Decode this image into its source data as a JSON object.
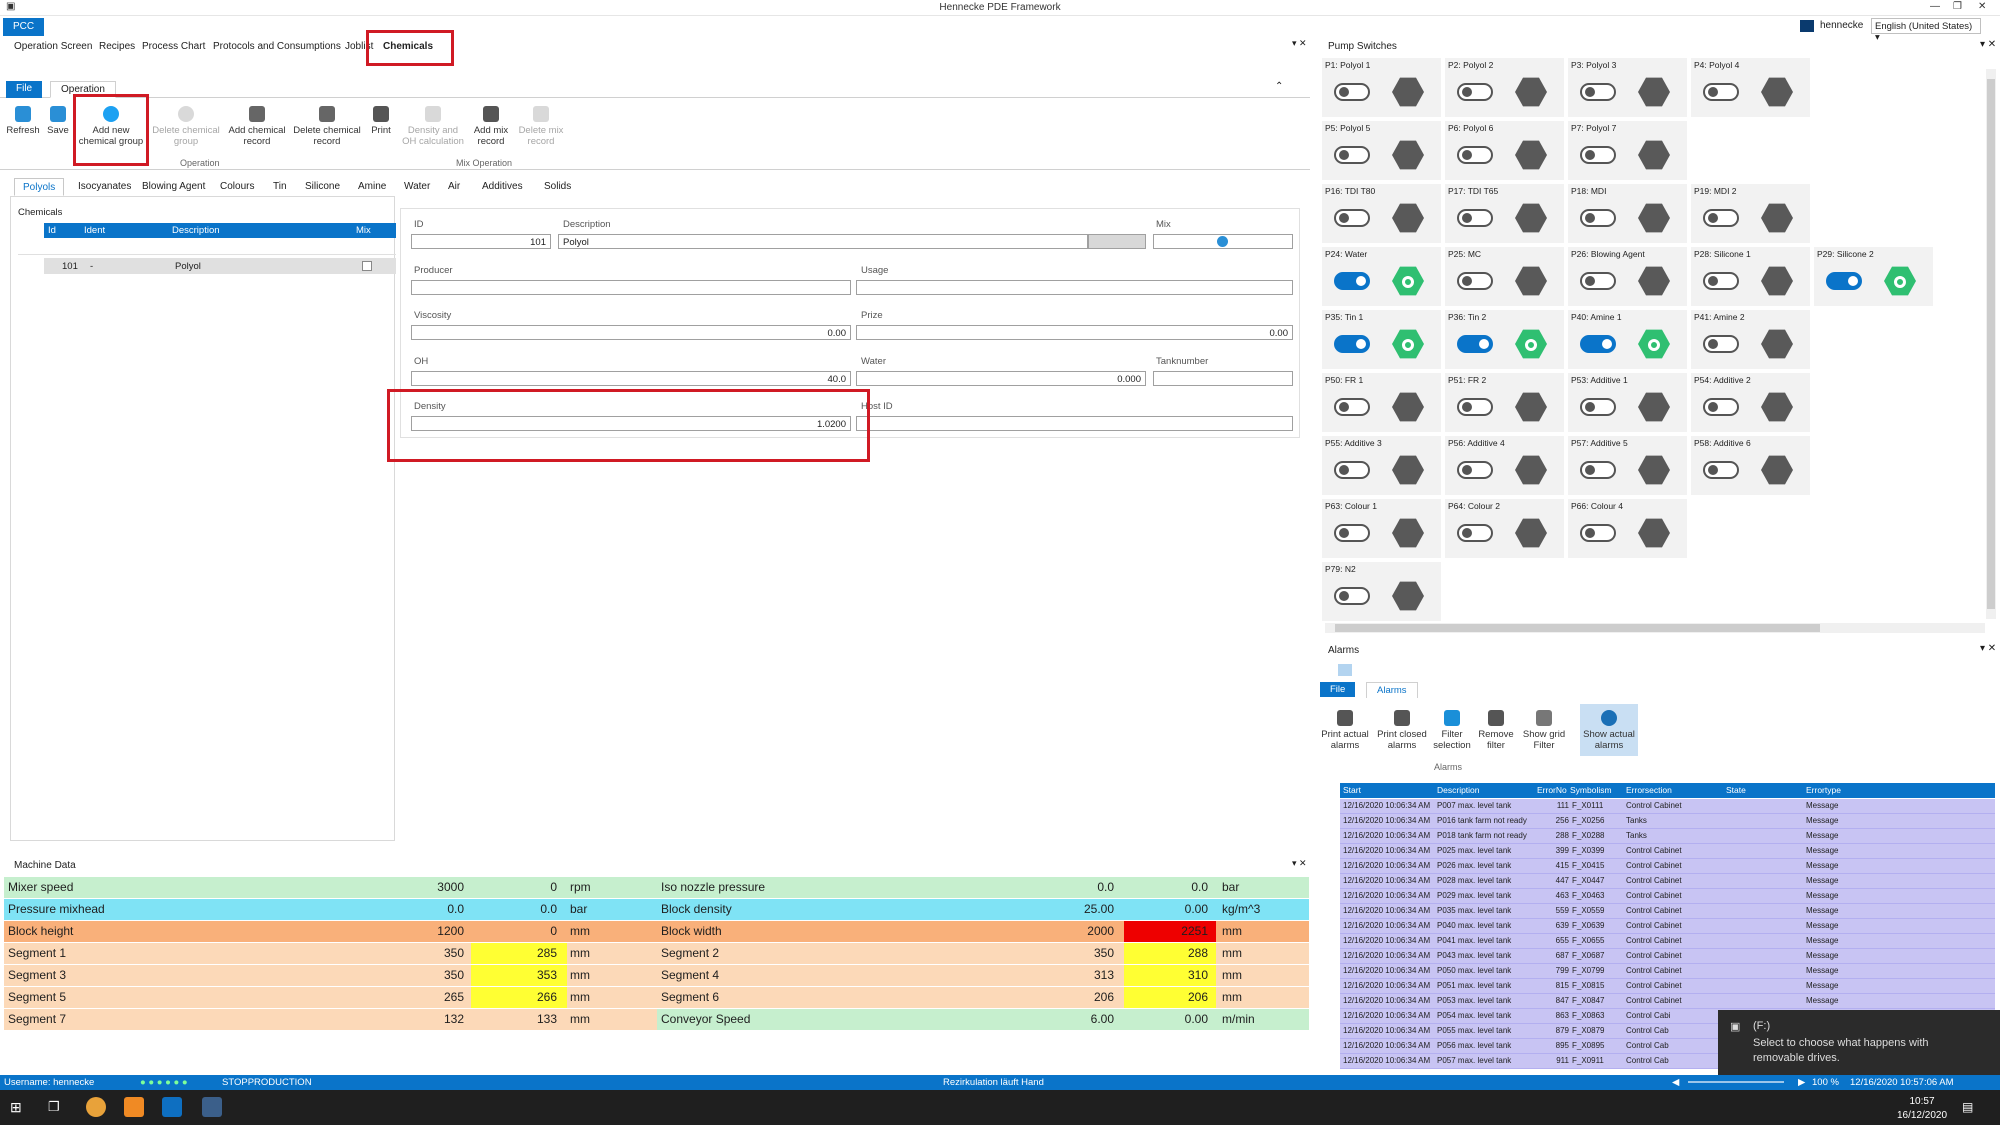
{
  "app": {
    "title": "Hennecke PDE Framework",
    "user": "hennecke",
    "language": "English (United States)",
    "pcc": "PCC"
  },
  "nav": {
    "tabs": [
      "Operation Screen",
      "Recipes",
      "Process Chart",
      "Protocols and Consumptions",
      "Joblist",
      "Chemicals"
    ],
    "active": "Chemicals"
  },
  "ribbon": {
    "tabs": {
      "file": "File",
      "operation": "Operation"
    },
    "buttons": {
      "refresh": "Refresh",
      "save": "Save",
      "add_group": "Add new chemical group",
      "delete_group": "Delete chemical group",
      "add_record": "Add chemical record",
      "delete_record": "Delete chemical record",
      "print": "Print",
      "density_oh": "Density and OH calculation",
      "add_mix": "Add mix record",
      "delete_mix": "Delete mix record"
    },
    "groups": {
      "operation": "Operation",
      "mix_operation": "Mix Operation"
    }
  },
  "chem_tabs": [
    "Polyols",
    "Isocyanates",
    "Blowing Agent",
    "Colours",
    "Tin",
    "Silicone",
    "Amine",
    "Water",
    "Air",
    "Additives",
    "Solids"
  ],
  "chemicals": {
    "label": "Chemicals",
    "columns": [
      "Id",
      "Ident",
      "Description",
      "Mix"
    ],
    "rows": [
      {
        "id": "101",
        "ident": "-",
        "description": "Polyol"
      }
    ]
  },
  "form": {
    "id_label": "ID",
    "id": "101",
    "desc_label": "Description",
    "desc": "Polyol",
    "mix_label": "Mix",
    "producer_label": "Producer",
    "usage_label": "Usage",
    "viscosity_label": "Viscosity",
    "viscosity": "0.00",
    "prize_label": "Prize",
    "prize": "0.00",
    "oh_label": "OH",
    "oh": "40.0",
    "water_label": "Water",
    "water": "0.000",
    "tank_label": "Tanknumber",
    "density_label": "Density",
    "density": "1.0200",
    "host_label": "Host ID"
  },
  "machine": {
    "title": "Machine Data",
    "rows": [
      {
        "l_name": "Mixer speed",
        "l_set": "3000",
        "l_act": "0",
        "l_unit": "rpm",
        "r_name": "Iso nozzle pressure",
        "r_set": "0.0",
        "r_act": "0.0",
        "r_unit": "bar",
        "l_color": "#c6efce",
        "r_color": "#c6efce",
        "l_act_color": "",
        "r_act_color": ""
      },
      {
        "l_name": "Pressure mixhead",
        "l_set": "0.0",
        "l_act": "0.0",
        "l_unit": "bar",
        "r_name": "Block density",
        "r_set": "25.00",
        "r_act": "0.00",
        "r_unit": "kg/m^3",
        "l_color": "#7fe3f5",
        "r_color": "#7fe3f5",
        "l_act_color": "",
        "r_act_color": ""
      },
      {
        "l_name": "Block height",
        "l_set": "1200",
        "l_act": "0",
        "l_unit": "mm",
        "r_name": "Block width",
        "r_set": "2000",
        "r_act": "2251",
        "r_unit": "mm",
        "l_color": "#f9b07a",
        "r_color": "#f9b07a",
        "l_act_color": "",
        "r_act_color": "#ee0000"
      },
      {
        "l_name": "Segment 1",
        "l_set": "350",
        "l_act": "285",
        "l_unit": "mm",
        "r_name": "Segment 2",
        "r_set": "350",
        "r_act": "288",
        "r_unit": "mm",
        "l_color": "#fcd9b8",
        "r_color": "#fcd9b8",
        "l_act_color": "#ffff33",
        "r_act_color": "#ffff33"
      },
      {
        "l_name": "Segment 3",
        "l_set": "350",
        "l_act": "353",
        "l_unit": "mm",
        "r_name": "Segment 4",
        "r_set": "313",
        "r_act": "310",
        "r_unit": "mm",
        "l_color": "#fcd9b8",
        "r_color": "#fcd9b8",
        "l_act_color": "#ffff33",
        "r_act_color": "#ffff33"
      },
      {
        "l_name": "Segment 5",
        "l_set": "265",
        "l_act": "266",
        "l_unit": "mm",
        "r_name": "Segment 6",
        "r_set": "206",
        "r_act": "206",
        "r_unit": "mm",
        "l_color": "#fcd9b8",
        "r_color": "#fcd9b8",
        "l_act_color": "#ffff33",
        "r_act_color": "#ffff33"
      },
      {
        "l_name": "Segment 7",
        "l_set": "132",
        "l_act": "133",
        "l_unit": "mm",
        "r_name": "Conveyor Speed",
        "r_set": "6.00",
        "r_act": "0.00",
        "r_unit": "m/min",
        "l_color": "#fcd9b8",
        "r_color": "#c6efce",
        "l_act_color": "",
        "r_act_color": ""
      }
    ]
  },
  "pumps": {
    "title": "Pump Switches",
    "items": [
      {
        "label": "P1: Polyol 1",
        "on": false
      },
      {
        "label": "P2: Polyol 2",
        "on": false
      },
      {
        "label": "P3: Polyol 3",
        "on": false
      },
      {
        "label": "P4: Polyol 4",
        "on": false
      },
      {
        "label": "P5: Polyol 5",
        "on": false
      },
      {
        "label": "P6: Polyol 6",
        "on": false
      },
      {
        "label": "P7: Polyol 7",
        "on": false
      },
      {
        "label": "P16: TDI T80",
        "on": false
      },
      {
        "label": "P17: TDI T65",
        "on": false
      },
      {
        "label": "P18: MDI",
        "on": false
      },
      {
        "label": "P19: MDI 2",
        "on": false
      },
      {
        "label": "P24: Water",
        "on": true
      },
      {
        "label": "P25: MC",
        "on": false
      },
      {
        "label": "P26: Blowing Agent",
        "on": false
      },
      {
        "label": "P28: Silicone 1",
        "on": false
      },
      {
        "label": "P29: Silicone 2",
        "on": true
      },
      {
        "label": "P35: Tin 1",
        "on": true
      },
      {
        "label": "P36: Tin 2",
        "on": true
      },
      {
        "label": "P40: Amine 1",
        "on": true
      },
      {
        "label": "P41: Amine 2",
        "on": false
      },
      {
        "label": "P50: FR 1",
        "on": false
      },
      {
        "label": "P51: FR 2",
        "on": false
      },
      {
        "label": "P53: Additive 1",
        "on": false
      },
      {
        "label": "P54: Additive 2",
        "on": false
      },
      {
        "label": "P55: Additive 3",
        "on": false
      },
      {
        "label": "P56: Additive 4",
        "on": false
      },
      {
        "label": "P57: Additive 5",
        "on": false
      },
      {
        "label": "P58: Additive 6",
        "on": false
      },
      {
        "label": "P63: Colour 1",
        "on": false
      },
      {
        "label": "P64: Colour 2",
        "on": false
      },
      {
        "label": "P66: Colour 4",
        "on": false
      },
      {
        "label": "P79: N2",
        "on": false
      }
    ]
  },
  "alarms": {
    "title": "Alarms",
    "tabs": {
      "file": "File",
      "alarms": "Alarms"
    },
    "buttons": {
      "print_actual": "Print actual alarms",
      "print_closed": "Print closed alarms",
      "filter": "Filter selection",
      "remove_filter": "Remove filter",
      "grid_filter": "Show grid Filter",
      "show_actual": "Show actual alarms"
    },
    "group": "Alarms",
    "columns": [
      "Start",
      "Description",
      "ErrorNo",
      "Symbolism",
      "Errorsection",
      "State",
      "Errortype"
    ],
    "rows": [
      {
        "start": "12/16/2020 10:06:34 AM",
        "desc": "P007 max. level tank",
        "no": "111",
        "sym": "F_X0111",
        "section": "Control Cabinet",
        "type": "Message"
      },
      {
        "start": "12/16/2020 10:06:34 AM",
        "desc": "P016 tank farm not ready",
        "no": "256",
        "sym": "F_X0256",
        "section": "Tanks",
        "type": "Message"
      },
      {
        "start": "12/16/2020 10:06:34 AM",
        "desc": "P018 tank farm not ready",
        "no": "288",
        "sym": "F_X0288",
        "section": "Tanks",
        "type": "Message"
      },
      {
        "start": "12/16/2020 10:06:34 AM",
        "desc": "P025 max. level tank",
        "no": "399",
        "sym": "F_X0399",
        "section": "Control Cabinet",
        "type": "Message"
      },
      {
        "start": "12/16/2020 10:06:34 AM",
        "desc": "P026 max. level tank",
        "no": "415",
        "sym": "F_X0415",
        "section": "Control Cabinet",
        "type": "Message"
      },
      {
        "start": "12/16/2020 10:06:34 AM",
        "desc": "P028 max. level tank",
        "no": "447",
        "sym": "F_X0447",
        "section": "Control Cabinet",
        "type": "Message"
      },
      {
        "start": "12/16/2020 10:06:34 AM",
        "desc": "P029 max. level tank",
        "no": "463",
        "sym": "F_X0463",
        "section": "Control Cabinet",
        "type": "Message"
      },
      {
        "start": "12/16/2020 10:06:34 AM",
        "desc": "P035 max. level tank",
        "no": "559",
        "sym": "F_X0559",
        "section": "Control Cabinet",
        "type": "Message"
      },
      {
        "start": "12/16/2020 10:06:34 AM",
        "desc": "P040 max. level tank",
        "no": "639",
        "sym": "F_X0639",
        "section": "Control Cabinet",
        "type": "Message"
      },
      {
        "start": "12/16/2020 10:06:34 AM",
        "desc": "P041 max. level tank",
        "no": "655",
        "sym": "F_X0655",
        "section": "Control Cabinet",
        "type": "Message"
      },
      {
        "start": "12/16/2020 10:06:34 AM",
        "desc": "P043 max. level tank",
        "no": "687",
        "sym": "F_X0687",
        "section": "Control Cabinet",
        "type": "Message"
      },
      {
        "start": "12/16/2020 10:06:34 AM",
        "desc": "P050 max. level tank",
        "no": "799",
        "sym": "F_X0799",
        "section": "Control Cabinet",
        "type": "Message"
      },
      {
        "start": "12/16/2020 10:06:34 AM",
        "desc": "P051 max. level tank",
        "no": "815",
        "sym": "F_X0815",
        "section": "Control Cabinet",
        "type": "Message"
      },
      {
        "start": "12/16/2020 10:06:34 AM",
        "desc": "P053 max. level tank",
        "no": "847",
        "sym": "F_X0847",
        "section": "Control Cabinet",
        "type": "Message"
      },
      {
        "start": "12/16/2020 10:06:34 AM",
        "desc": "P054 max. level tank",
        "no": "863",
        "sym": "F_X0863",
        "section": "Control Cabi",
        "type": ""
      },
      {
        "start": "12/16/2020 10:06:34 AM",
        "desc": "P055 max. level tank",
        "no": "879",
        "sym": "F_X0879",
        "section": "Control Cab",
        "type": ""
      },
      {
        "start": "12/16/2020 10:06:34 AM",
        "desc": "P056 max. level tank",
        "no": "895",
        "sym": "F_X0895",
        "section": "Control Cab",
        "type": ""
      },
      {
        "start": "12/16/2020 10:06:34 AM",
        "desc": "P057 max. level tank",
        "no": "911",
        "sym": "F_X0911",
        "section": "Control Cab",
        "type": ""
      }
    ]
  },
  "status": {
    "user": "Username: hennecke",
    "state": "STOPPRODUCTION",
    "message": "Rezirkulation läuft Hand",
    "zoom": "100 %",
    "datetime": "12/16/2020 10:57:06 AM"
  },
  "taskbar": {
    "time": "10:57",
    "date": "16/12/2020"
  },
  "notification": {
    "title": "(F:)",
    "body": "Select to choose what happens with removable drives."
  }
}
